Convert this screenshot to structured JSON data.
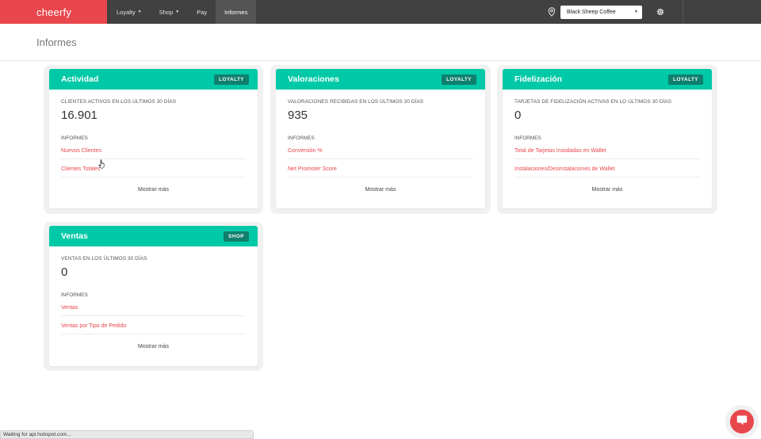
{
  "brand": "cheerfy",
  "nav": {
    "items": [
      {
        "label": "Loyalty",
        "dropdown": true
      },
      {
        "label": "Shop",
        "dropdown": true
      },
      {
        "label": "Pay"
      },
      {
        "label": "Informes",
        "active": true
      }
    ],
    "store_select": "Black Sheep Coffee"
  },
  "page": {
    "title": "Informes"
  },
  "cards": [
    {
      "title": "Actividad",
      "badge": "LOYALTY",
      "metric_label": "CLIENTES ACTIVOS EN LOS ÚLTIMOS 30 DÍAS",
      "metric_value": "16.901",
      "reports_label": "INFORMES",
      "links": [
        "Nuevos Clientes",
        "Clientes Totales"
      ],
      "show_more": "Mostrar más"
    },
    {
      "title": "Valoraciones",
      "badge": "LOYALTY",
      "metric_label": "VALORACIONES RECIBIDAS EN LOS ÚLTIMOS 30 DÍAS",
      "metric_value": "935",
      "reports_label": "INFORMES",
      "links": [
        "Conversión %",
        "Net Promoter Score"
      ],
      "show_more": "Mostrar más"
    },
    {
      "title": "Fidelización",
      "badge": "LOYALTY",
      "metric_label": "TARJETAS DE FIDELIZACIÓN ACTIVAS EN LO ÚLTIMOS 30 DÍAS",
      "metric_value": "0",
      "reports_label": "INFORMES",
      "links": [
        "Total de Tarjetas Instaladas en Wallet",
        "Instalaciones/Desinstalaciones de Wallet"
      ],
      "show_more": "Mostrar más"
    },
    {
      "title": "Ventas",
      "badge": "SHOP",
      "metric_label": "VENTAS EN LOS ÚLTIMOS 30 DÍAS",
      "metric_value": "0",
      "reports_label": "INFORMES",
      "links": [
        "Ventas",
        "Ventas por Tipo de Pedido"
      ],
      "show_more": "Mostrar más"
    }
  ],
  "status_bar": "Waiting for api.hubspot.com...",
  "colors": {
    "accent": "#00c9a7",
    "brand": "#e8474d",
    "badge": "#0f7f6e",
    "topbar": "#414141"
  },
  "icons": [
    "location-pin-icon",
    "gear-icon",
    "chevron-down-icon",
    "hand-cursor-icon",
    "chat-icon"
  ]
}
